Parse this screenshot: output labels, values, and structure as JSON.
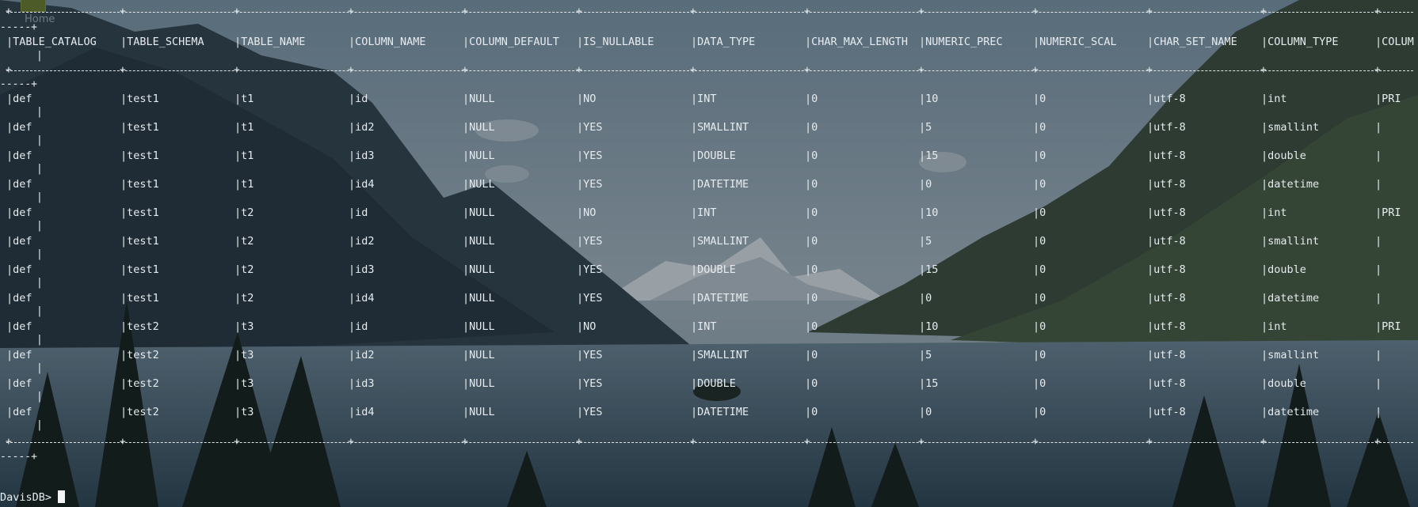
{
  "desktop": {
    "home_label": "Home"
  },
  "table": {
    "columns": [
      "TABLE_CATALOG",
      "TABLE_SCHEMA",
      "TABLE_NAME",
      "COLUMN_NAME",
      "COLUMN_DEFAULT",
      "IS_NULLABLE",
      "DATA_TYPE",
      "CHAR_MAX_LENGTH",
      "NUMERIC_PREC",
      "NUMERIC_SCAL",
      "CHAR_SET_NAME",
      "COLUMN_TYPE",
      "COLUM"
    ],
    "rows": [
      [
        "def",
        "test1",
        "t1",
        "id",
        "NULL",
        "NO",
        "INT",
        "0",
        "10",
        "0",
        "utf-8",
        "int",
        "PRI"
      ],
      [
        "def",
        "test1",
        "t1",
        "id2",
        "NULL",
        "YES",
        "SMALLINT",
        "0",
        "5",
        "0",
        "utf-8",
        "smallint",
        ""
      ],
      [
        "def",
        "test1",
        "t1",
        "id3",
        "NULL",
        "YES",
        "DOUBLE",
        "0",
        "15",
        "0",
        "utf-8",
        "double",
        ""
      ],
      [
        "def",
        "test1",
        "t1",
        "id4",
        "NULL",
        "YES",
        "DATETIME",
        "0",
        "0",
        "0",
        "utf-8",
        "datetime",
        ""
      ],
      [
        "def",
        "test1",
        "t2",
        "id",
        "NULL",
        "NO",
        "INT",
        "0",
        "10",
        "0",
        "utf-8",
        "int",
        "PRI"
      ],
      [
        "def",
        "test1",
        "t2",
        "id2",
        "NULL",
        "YES",
        "SMALLINT",
        "0",
        "5",
        "0",
        "utf-8",
        "smallint",
        ""
      ],
      [
        "def",
        "test1",
        "t2",
        "id3",
        "NULL",
        "YES",
        "DOUBLE",
        "0",
        "15",
        "0",
        "utf-8",
        "double",
        ""
      ],
      [
        "def",
        "test1",
        "t2",
        "id4",
        "NULL",
        "YES",
        "DATETIME",
        "0",
        "0",
        "0",
        "utf-8",
        "datetime",
        ""
      ],
      [
        "def",
        "test2",
        "t3",
        "id",
        "NULL",
        "NO",
        "INT",
        "0",
        "10",
        "0",
        "utf-8",
        "int",
        "PRI"
      ],
      [
        "def",
        "test2",
        "t3",
        "id2",
        "NULL",
        "YES",
        "SMALLINT",
        "0",
        "5",
        "0",
        "utf-8",
        "smallint",
        ""
      ],
      [
        "def",
        "test2",
        "t3",
        "id3",
        "NULL",
        "YES",
        "DOUBLE",
        "0",
        "15",
        "0",
        "utf-8",
        "double",
        ""
      ],
      [
        "def",
        "test2",
        "t3",
        "id4",
        "NULL",
        "YES",
        "DATETIME",
        "0",
        "0",
        "0",
        "utf-8",
        "datetime",
        ""
      ]
    ]
  },
  "prompt": {
    "text": "DavisDB>"
  }
}
